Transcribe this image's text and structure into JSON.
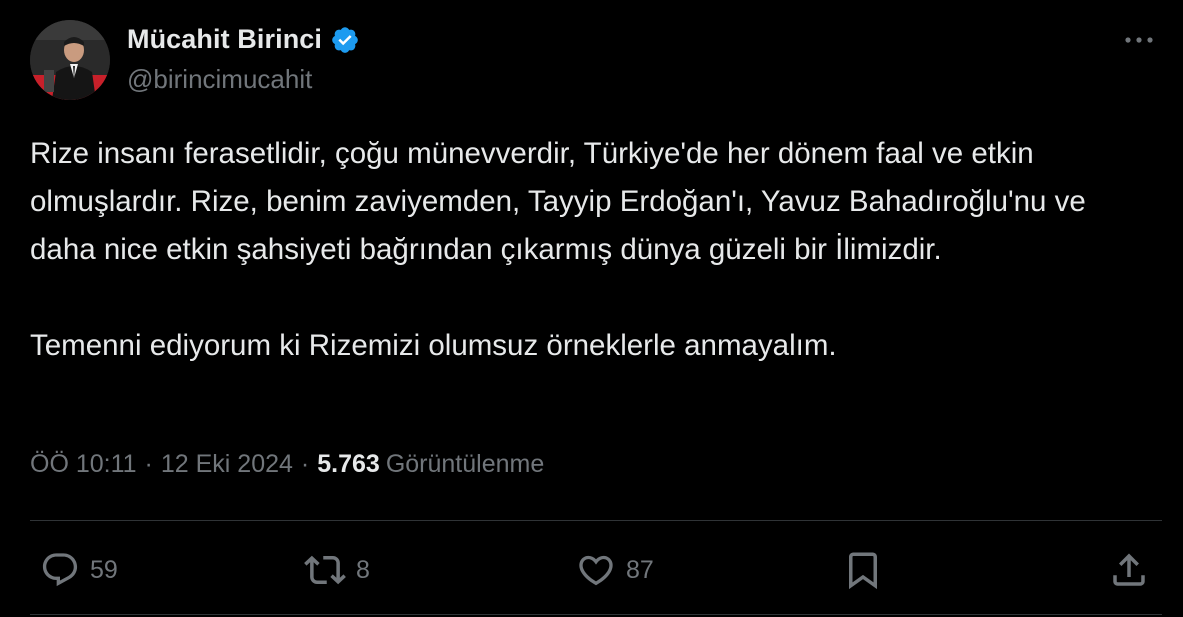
{
  "author": {
    "display_name": "Mücahit Birinci",
    "handle": "@birincimucahit",
    "verified": true
  },
  "tweet": {
    "paragraphs": [
      "Rize insanı ferasetlidir, çoğu münevverdir, Türkiye'de her dönem faal ve etkin olmuşlardır. Rize, benim zaviyemden, Tayyip Erdoğan'ı, Yavuz Bahadıroğlu'nu ve daha nice etkin şahsiyeti bağrından çıkarmış dünya güzeli bir İlimizdir.",
      "Temenni ediyorum ki Rizemizi olumsuz örneklerle anmayalım."
    ],
    "time": "ÖÖ 10:11",
    "date": "12 Eki 2024",
    "separator": "·",
    "views_count": "5.763",
    "views_label": "Görüntülenme"
  },
  "actions": {
    "reply_count": "59",
    "retweet_count": "8",
    "like_count": "87"
  },
  "colors": {
    "background": "#000000",
    "text": "#e7e9ea",
    "secondary_text": "#71767b",
    "divider": "#2f3336",
    "verified_badge": "#1d9bf0"
  },
  "icons": {
    "verified": "verified-badge-icon",
    "more": "more-horizontal-icon",
    "reply": "reply-bubble-icon",
    "retweet": "retweet-arrows-icon",
    "like": "heart-icon",
    "bookmark": "bookmark-icon",
    "share": "share-upload-icon"
  }
}
